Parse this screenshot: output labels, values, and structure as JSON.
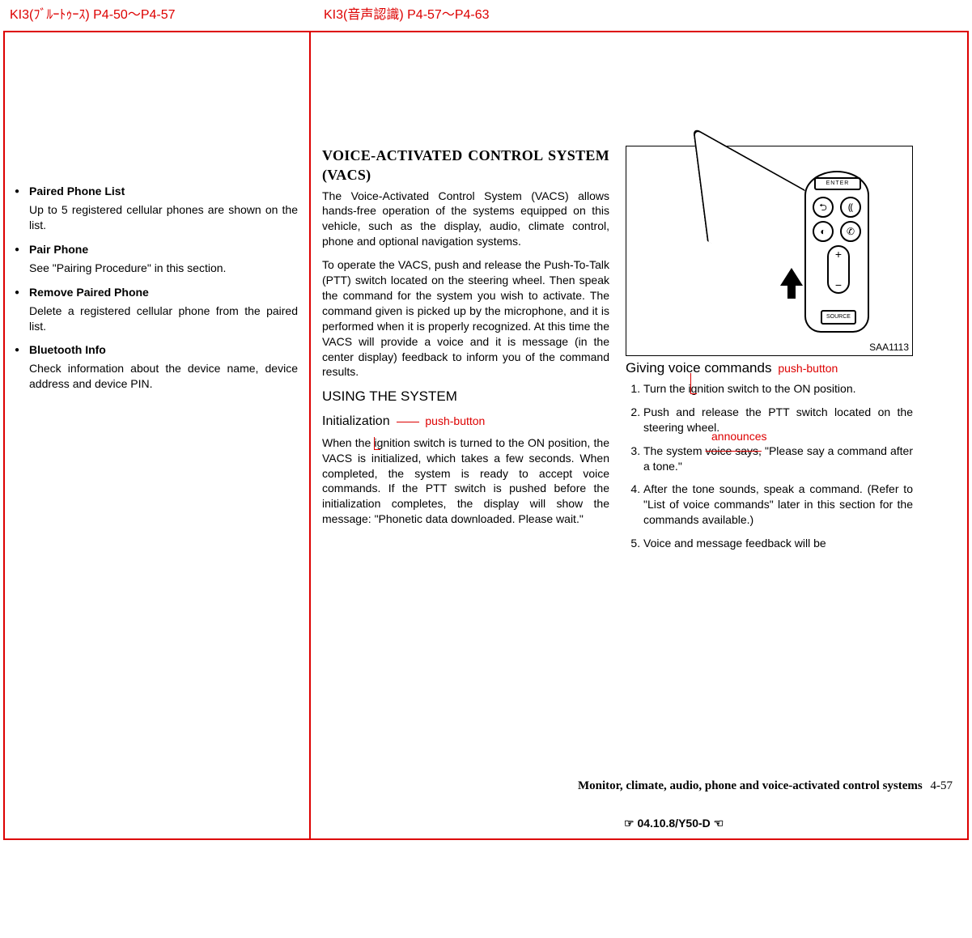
{
  "header": {
    "left": "KI3(ﾌﾞﾙｰﾄｩｰｽ) P4-50～P4-57",
    "right": "KI3(音声認識) P4-57～P4-63"
  },
  "left_items": [
    {
      "title": "Paired Phone List",
      "body": "Up to 5 registered cellular phones are shown on the list."
    },
    {
      "title": "Pair Phone",
      "body": "See \"Pairing Procedure\" in this section."
    },
    {
      "title": "Remove Paired Phone",
      "body": "Delete a registered cellular phone from the paired list."
    },
    {
      "title": "Bluetooth Info",
      "body": "Check information about the device name, device address and device PIN."
    }
  ],
  "vacs": {
    "title": "VOICE-ACTIVATED CONTROL SYSTEM (VACS)",
    "intro": "The Voice-Activated Control System (VACS) allows hands-free operation of the systems equipped on this vehicle, such as the display, audio, climate control, phone and optional navigation systems.",
    "operate": "To operate the VACS, push and release the Push-To-Talk (PTT) switch        located on the steering wheel. Then speak the command for the system you wish to activate. The command given is picked up by the microphone, and it is performed when it is properly recognized. At this time the VACS will provide a voice and it is message (in the center display) feedback to inform you of the command results.",
    "using_title": "USING THE SYSTEM",
    "init_title": "Initialization",
    "init_annot": "push-button",
    "init_body_a": "When the ",
    "init_body_b": "ignition switch is turned to the ON position, the VACS is initialized, which takes a few seconds. When completed, the system is ready to accept voice commands. If the PTT switch is pushed before the initialization completes, the display will show the message: \"Phonetic data downloaded. Please wait.\""
  },
  "image": {
    "code": "SAA1113",
    "enter": "ENTER",
    "source": "SOURCE"
  },
  "giving": {
    "title": "Giving voice commands",
    "annot_pb": "push-button",
    "step1a": "Turn the ",
    "step1b": "ignition switch to the ON position.",
    "step2": "Push and release the PTT switch located on the steering wheel.",
    "step3a": "The system ",
    "step3_strike": "voice says,",
    "step3_annot": "announces",
    "step3b": " \"Please say a command after a tone.\"",
    "step4": "After the tone sounds, speak a command. (Refer to \"List of voice commands\" later in this section for the commands available.)",
    "step5": "Voice and message feedback will be"
  },
  "footer": {
    "section": "Monitor, climate, audio, phone and voice-activated control systems",
    "page": "4-57",
    "docref": "☞ 04.10.8/Y50-D ☜"
  }
}
